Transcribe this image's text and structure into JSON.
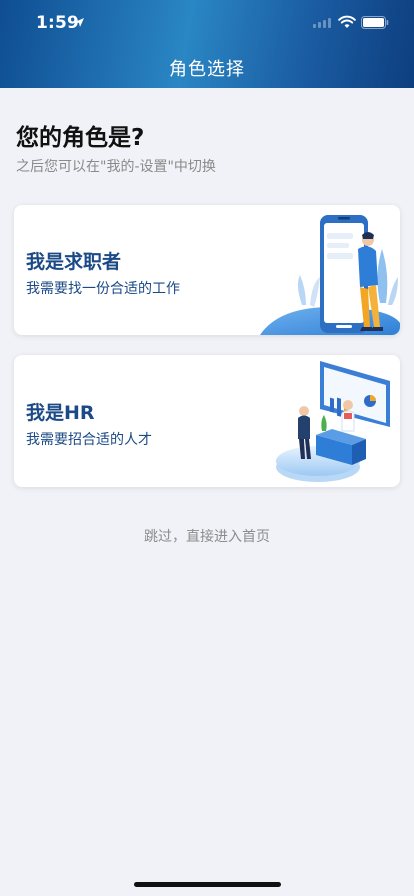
{
  "status_bar": {
    "time": "1:59",
    "icons": [
      "location-arrow-icon",
      "cellular-signal-icon",
      "wifi-icon",
      "battery-icon"
    ]
  },
  "nav": {
    "title": "角色选择"
  },
  "heading": {
    "title": "您的角色是?",
    "subtitle": "之后您可以在\"我的-设置\"中切换"
  },
  "roles": [
    {
      "title": "我是求职者",
      "description": "我需要找一份合适的工作",
      "illustration": "job-seeker-phone-illustration"
    },
    {
      "title": "我是HR",
      "description": "我需要招合适的人才",
      "illustration": "hr-presentation-illustration"
    }
  ],
  "skip": {
    "label": "跳过，直接进入首页"
  },
  "colors": {
    "header_gradient_mid": "#2a86c4",
    "header_gradient_dark": "#0f4d92",
    "card_title": "#1b4a86",
    "background": "#f1f2f7"
  }
}
